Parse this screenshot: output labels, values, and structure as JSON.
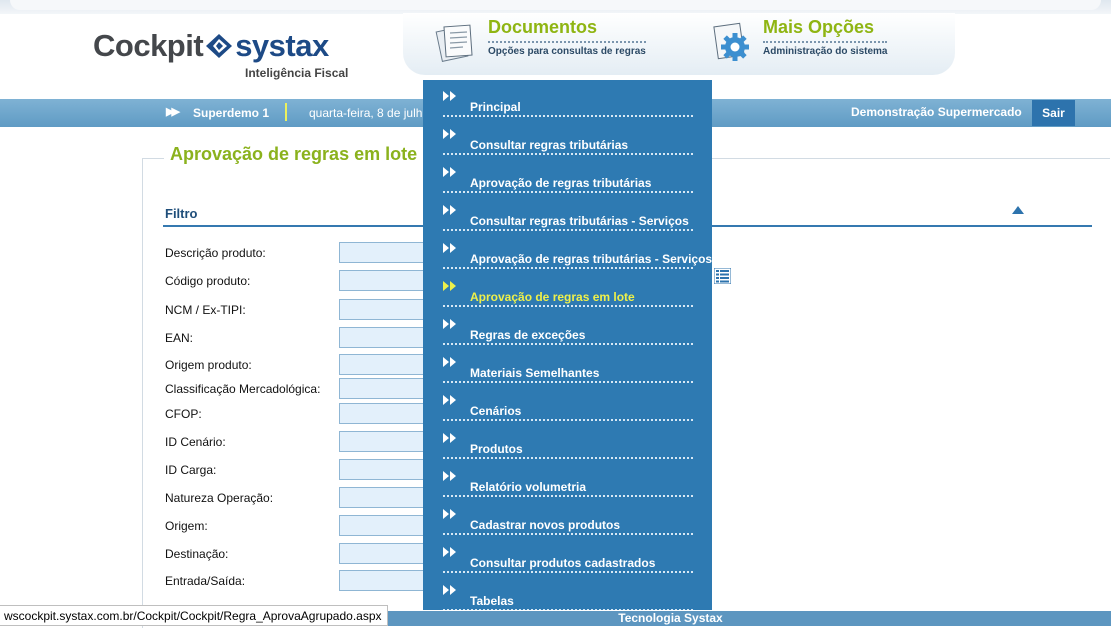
{
  "header": {
    "logo_main": "Cockpit",
    "logo_brand": "systax",
    "logo_sub": "Inteligência Fiscal",
    "menus": [
      {
        "title": "Documentos",
        "subtitle": "Opções para consultas de regras",
        "icon": "documents-icon"
      },
      {
        "title": "Mais Opções",
        "subtitle": "Administração do sistema",
        "icon": "gear-icon"
      }
    ]
  },
  "bar": {
    "user": "Superdemo 1",
    "date": "quarta-feira, 8 de julh",
    "company": "Demonstração Supermercado",
    "logout": "Sair"
  },
  "page": {
    "title": "Aprovação de regras em lote",
    "filter_title": "Filtro",
    "fields": [
      {
        "label": "Descrição produto:",
        "value": ""
      },
      {
        "label": "Código produto:",
        "value": ""
      },
      {
        "label": "NCM / Ex-TIPI:",
        "value": ""
      },
      {
        "label": "EAN:",
        "value": ""
      },
      {
        "label": "Origem produto:",
        "value": ""
      },
      {
        "label": "Classificação Mercadológica:",
        "value": ""
      },
      {
        "label": "CFOP:",
        "value": ""
      },
      {
        "label": "ID Cenário:",
        "value": ""
      },
      {
        "label": "ID Carga:",
        "value": ""
      },
      {
        "label": "Natureza Operação:",
        "value": ""
      },
      {
        "label": "Origem:",
        "value": ""
      },
      {
        "label": "Destinação:",
        "value": ""
      },
      {
        "label": "Entrada/Saída:",
        "value": ""
      }
    ]
  },
  "dropdown": {
    "items": [
      {
        "label": "Principal",
        "active": false
      },
      {
        "label": "Consultar regras tributárias",
        "active": false
      },
      {
        "label": "Aprovação de regras tributárias",
        "active": false
      },
      {
        "label": "Consultar regras tributárias - Serviços",
        "active": false
      },
      {
        "label": "Aprovação de regras tributárias - Serviços",
        "active": false
      },
      {
        "label": "Aprovação de regras em lote",
        "active": true
      },
      {
        "label": "Regras de exceções",
        "active": false
      },
      {
        "label": "Materiais Semelhantes",
        "active": false
      },
      {
        "label": "Cenários",
        "active": false
      },
      {
        "label": "Produtos",
        "active": false
      },
      {
        "label": "Relatório volumetria",
        "active": false
      },
      {
        "label": "Cadastrar novos produtos",
        "active": false
      },
      {
        "label": "Consultar produtos cadastrados",
        "active": false
      },
      {
        "label": "Tabelas",
        "active": false
      }
    ]
  },
  "footer": {
    "text": "Tecnologia Systax"
  },
  "status": {
    "url": "wscockpit.systax.com.br/Cockpit/Cockpit/Regra_AprovaAgrupado.aspx"
  },
  "colors": {
    "accent_green": "#8bb21d",
    "bar_blue": "#6aa4cc",
    "menu_blue": "#2e7ab2",
    "active_yellow": "#eef04a"
  }
}
